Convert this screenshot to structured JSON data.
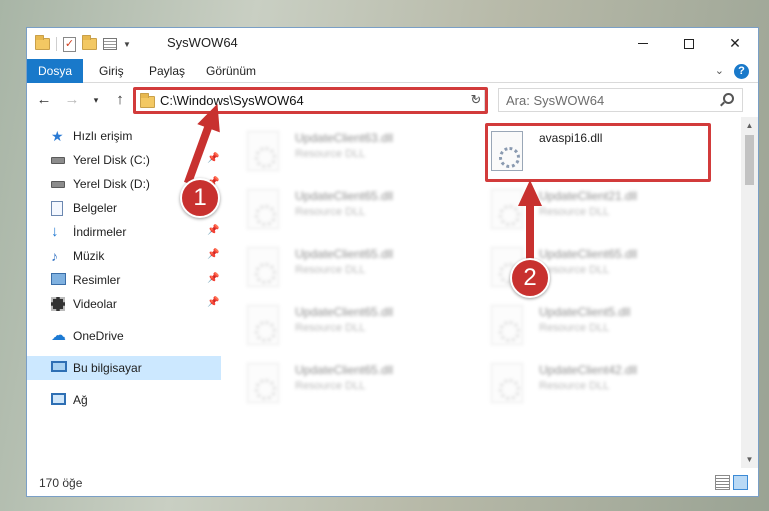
{
  "window": {
    "title": "SysWOW64",
    "controls": {
      "minimize": "—",
      "maximize": "☐",
      "close": "✕"
    }
  },
  "ribbon": {
    "tabs": [
      "Dosya",
      "Giriş",
      "Paylaş",
      "Görünüm"
    ],
    "help": "?"
  },
  "navigation": {
    "back": "←",
    "forward": "→",
    "recent": "▾",
    "up": "↑",
    "address": "C:\\Windows\\SysWOW64",
    "refresh": "↻",
    "search_placeholder": "Ara: SysWOW64"
  },
  "sidebar": {
    "items": [
      {
        "label": "Hızlı erişim",
        "icon": "star-icon"
      },
      {
        "label": "Yerel Disk (C:)",
        "icon": "drive-icon",
        "pinned": true
      },
      {
        "label": "Yerel Disk (D:)",
        "icon": "drive-icon",
        "pinned": true
      },
      {
        "label": "Belgeler",
        "icon": "document-icon",
        "pinned": true
      },
      {
        "label": "İndirmeler",
        "icon": "download-icon",
        "pinned": true
      },
      {
        "label": "Müzik",
        "icon": "music-icon",
        "pinned": true
      },
      {
        "label": "Resimler",
        "icon": "pictures-icon",
        "pinned": true
      },
      {
        "label": "Videolar",
        "icon": "video-icon",
        "pinned": true
      },
      {
        "label": "OneDrive",
        "icon": "onedrive-icon"
      },
      {
        "label": "Bu bilgisayar",
        "icon": "pc-icon",
        "selected": true
      },
      {
        "label": "Ağ",
        "icon": "network-icon"
      }
    ]
  },
  "files": [
    {
      "name": "UpdateClient63.dll",
      "type": "Resource DLL",
      "blurred": true
    },
    {
      "name": "avaspi16.dll",
      "type": "",
      "blurred": false,
      "highlighted": true
    },
    {
      "name": "UpdateClient65.dll",
      "type": "Resource DLL",
      "blurred": true
    },
    {
      "name": "UpdateClient21.dll",
      "type": "Resource DLL",
      "blurred": true
    },
    {
      "name": "UpdateClient65.dll",
      "type": "Resource DLL",
      "blurred": true
    },
    {
      "name": "UpdateClient65.dll",
      "type": "Resource DLL",
      "blurred": true
    },
    {
      "name": "UpdateClient65.dll",
      "type": "Resource DLL",
      "blurred": true
    },
    {
      "name": "UpdateClient5.dll",
      "type": "Resource DLL",
      "blurred": true
    },
    {
      "name": "UpdateClient65.dll",
      "type": "Resource DLL",
      "blurred": true
    },
    {
      "name": "UpdateClient42.dll",
      "type": "Resource DLL",
      "blurred": true
    }
  ],
  "annotations": {
    "step1": "1",
    "step2": "2",
    "color": "#c8312f"
  },
  "status": {
    "item_count": "170 öğe"
  },
  "colors": {
    "accent": "#1979ca",
    "selection": "#cce8ff"
  }
}
